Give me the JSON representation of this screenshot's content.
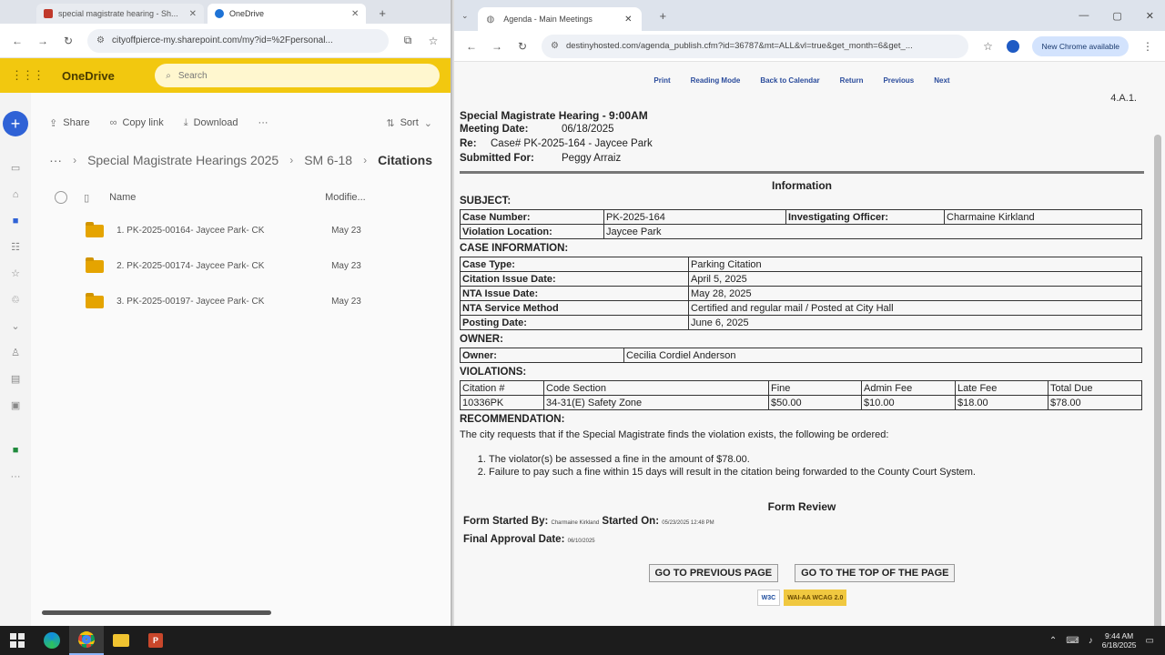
{
  "left_window": {
    "tabs": [
      {
        "label": "special magistrate hearing - Sh..."
      },
      {
        "label": "OneDrive"
      }
    ],
    "address": "cityoffpierce-my.sharepoint.com/my?id=%2Fpersonal...",
    "onedrive": {
      "brand": "OneDrive",
      "search_placeholder": "Search",
      "commands": {
        "share": "Share",
        "copy_link": "Copy link",
        "download": "Download",
        "more": "···",
        "sort": "Sort"
      },
      "breadcrumb": [
        "Special Magistrate Hearings 2025",
        "SM 6-18",
        "Citations"
      ],
      "breadcrumb_more": "···",
      "columns": {
        "name": "Name",
        "modified": "Modifie..."
      },
      "files": [
        {
          "name": "1. PK-2025-00164- Jaycee Park- CK",
          "modified": "May 23"
        },
        {
          "name": "2. PK-2025-00174- Jaycee Park- CK",
          "modified": "May 23"
        },
        {
          "name": "3. PK-2025-00197- Jaycee Park- CK",
          "modified": "May 23"
        }
      ]
    }
  },
  "right_window": {
    "tab": {
      "label": "Agenda - Main Meetings"
    },
    "address": "destinyhosted.com/agenda_publish.cfm?id=36787&mt=ALL&vl=true&get_month=6&get_...",
    "chrome_pill": "New Chrome available",
    "doc": {
      "toplinks": [
        "Print",
        "Reading Mode",
        "Back to Calendar",
        "Return",
        "Previous",
        "Next"
      ],
      "page_id": "4.A.1.",
      "title": "Special Magistrate Hearing - 9:00AM",
      "meeting_date_label": "Meeting Date:",
      "meeting_date": "06/18/2025",
      "re_label": "Re:",
      "re": "Case# PK-2025-164 - Jaycee Park",
      "submitted_label": "Submitted For:",
      "submitted": "Peggy Arraiz",
      "information": "Information",
      "subject_h": "SUBJECT:",
      "subject": {
        "case_number_label": "Case Number:",
        "case_number": "PK-2025-164",
        "officer_label": "Investigating Officer:",
        "officer": "Charmaine Kirkland",
        "location_label": "Violation Location:",
        "location": "Jaycee Park"
      },
      "case_info_h": "CASE INFORMATION:",
      "case_info": [
        {
          "k": "Case Type:",
          "v": "Parking Citation"
        },
        {
          "k": "Citation Issue Date:",
          "v": "April 5, 2025"
        },
        {
          "k": "NTA Issue Date:",
          "v": "May 28, 2025"
        },
        {
          "k": "NTA Service Method",
          "v": "Certified and regular mail / Posted at City Hall"
        },
        {
          "k": "Posting Date:",
          "v": "June 6, 2025"
        }
      ],
      "owner_h": "OWNER:",
      "owner_label": "Owner:",
      "owner": "Cecilia Cordiel Anderson",
      "violations_h": "VIOLATIONS:",
      "violations_head": [
        "Citation #",
        "Code Section",
        "Fine",
        "Admin Fee",
        "Late Fee",
        "Total Due"
      ],
      "violations_row": [
        "10336PK",
        "34-31(E) Safety Zone",
        "$50.00",
        "$10.00",
        "$18.00",
        "$78.00"
      ],
      "recommendation_h": "RECOMMENDATION:",
      "recommendation": "The city requests that if the Special Magistrate finds the violation exists, the following be ordered:",
      "rec_items": [
        "The violator(s) be assessed a fine in the amount of $78.00.",
        "Failure to pay such a fine within 15 days will result in the citation being forwarded to the County Court System."
      ],
      "form_review_h": "Form Review",
      "form_started_by_label": "Form Started By:",
      "form_started_by": "Charmaine Kirkland",
      "started_on_label": "Started On:",
      "started_on": "05/23/2025 12:48 PM",
      "final_approval_label": "Final Approval Date:",
      "final_approval": "06/10/2025",
      "btn_prev": "GO TO PREVIOUS PAGE",
      "btn_top": "GO TO THE TOP OF THE PAGE",
      "badge_w3c": "W3C",
      "badge_aa": "WAI-AA WCAG 2.0"
    }
  },
  "taskbar": {
    "time": "9:44 AM",
    "date": "6/18/2025"
  }
}
